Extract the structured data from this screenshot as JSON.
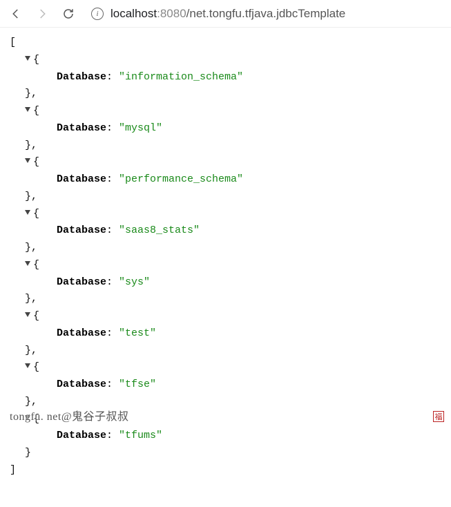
{
  "toolbar": {
    "url_host": "localhost",
    "url_port": ":8080",
    "url_path": "/net.tongfu.tfjava.jdbcTemplate"
  },
  "json": {
    "open_bracket": "[",
    "close_bracket": "]",
    "open_brace": "{",
    "close_brace": "}",
    "close_brace_comma": "},",
    "key_label": "Database",
    "items": [
      {
        "value": "information_schema"
      },
      {
        "value": "mysql"
      },
      {
        "value": "performance_schema"
      },
      {
        "value": "saas8_stats"
      },
      {
        "value": "sys"
      },
      {
        "value": "test"
      },
      {
        "value": "tfse"
      },
      {
        "value": "tfums"
      }
    ]
  },
  "watermark": "tongfu. net@鬼谷子叔叔",
  "seal": "福"
}
